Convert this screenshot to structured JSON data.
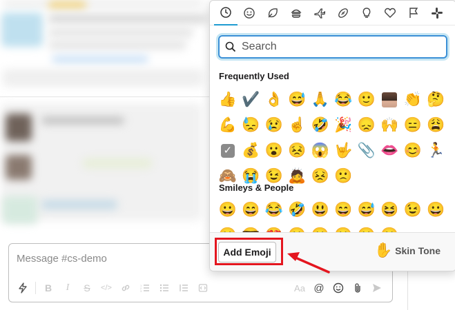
{
  "composer": {
    "placeholder": "Message #cs-demo"
  },
  "picker": {
    "categories": [
      {
        "name": "recent",
        "active": true
      },
      {
        "name": "smileys"
      },
      {
        "name": "nature"
      },
      {
        "name": "food"
      },
      {
        "name": "travel"
      },
      {
        "name": "activity"
      },
      {
        "name": "objects"
      },
      {
        "name": "symbols"
      },
      {
        "name": "flags"
      },
      {
        "name": "slack"
      }
    ],
    "search_placeholder": "Search",
    "frequently_used_title": "Frequently Used",
    "frequently_used": [
      "👍",
      "✔️",
      "👌",
      "😅",
      "🙏",
      "😂",
      "🙂",
      "[avatar]",
      "👏",
      "🤔",
      "💪",
      "😓",
      "😢",
      "☝️",
      "🤣",
      "🎉",
      "😞",
      "🙌",
      "😑",
      "😩",
      "[check]",
      "💰",
      "😮",
      "😣",
      "😱",
      "🤟",
      "📎",
      "👄",
      "😊",
      "🏃",
      "🙈",
      "😭",
      "😉",
      "🙇",
      "😣",
      "🙁"
    ],
    "smileys_title": "Smileys & People",
    "smileys": [
      "😀",
      "😄",
      "😂",
      "🤣",
      "😃",
      "😄",
      "😅",
      "😆",
      "😉",
      "😀",
      "😀",
      "😎",
      "😍",
      "😀",
      "😀",
      "😀",
      "😀",
      "😀"
    ],
    "add_emoji_label": "Add Emoji",
    "skin_tone_label": "Skin Tone",
    "skin_tone_emoji": "✋"
  },
  "colors": {
    "accent": "#1d9bd1",
    "highlight": "#e4161f"
  }
}
